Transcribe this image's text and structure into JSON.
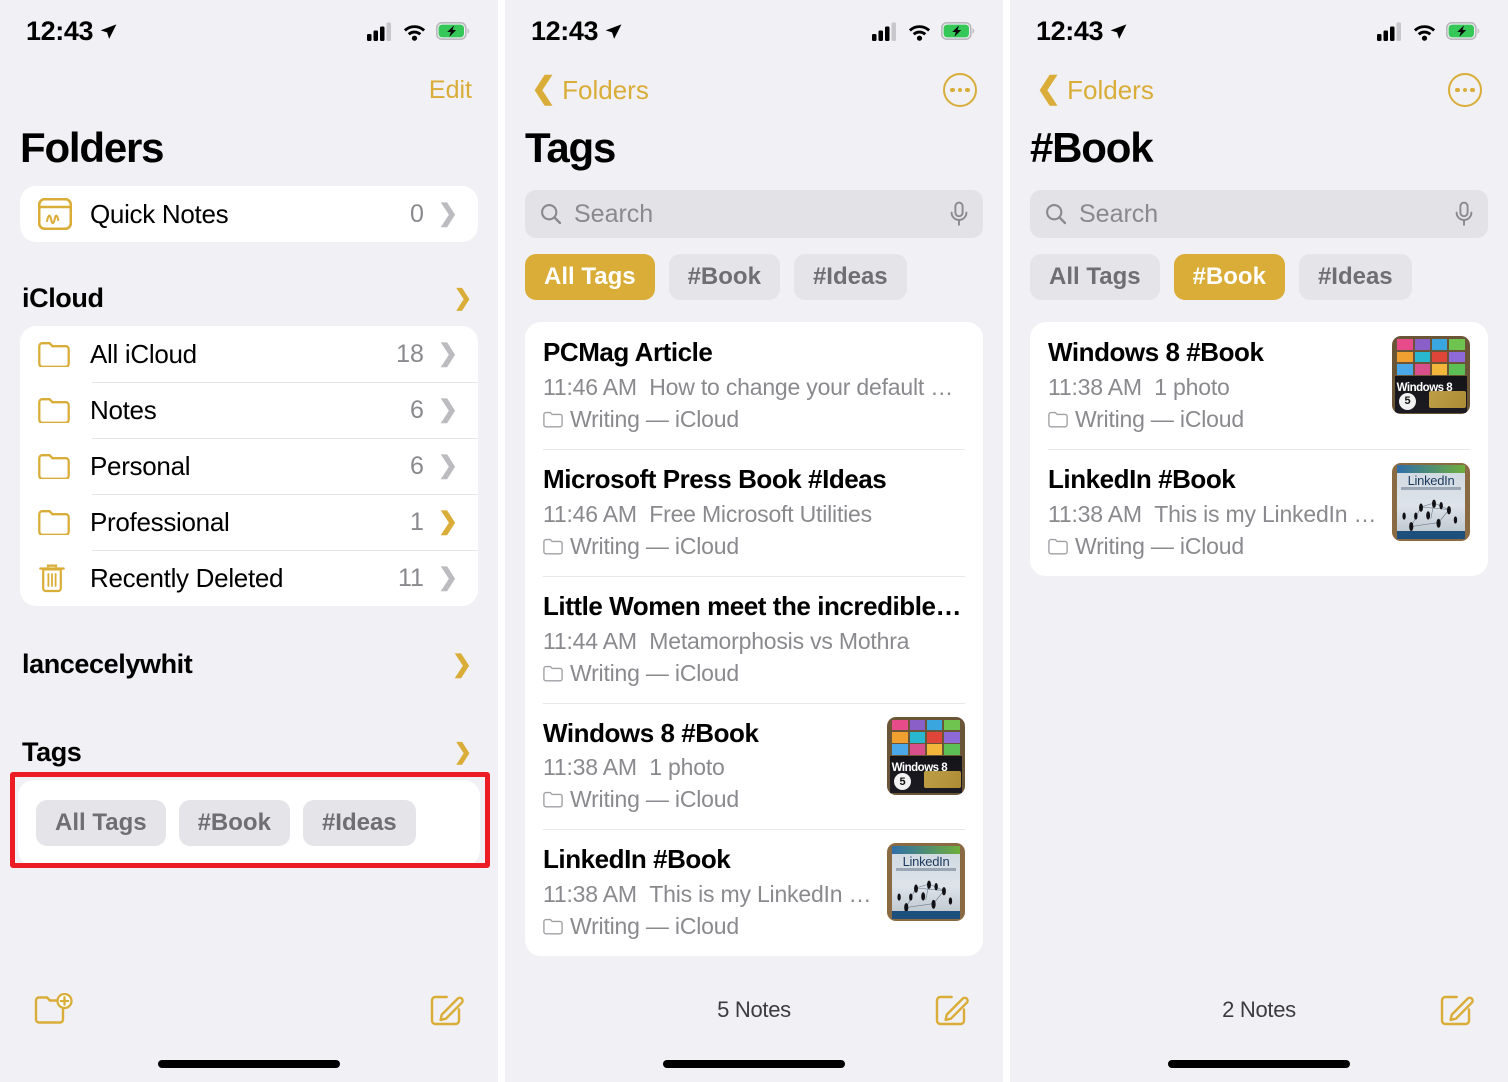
{
  "statusbar": {
    "time": "12:43",
    "location_icon": "location-arrow-icon",
    "cellular_icon": "cellular-signal-icon",
    "wifi_icon": "wifi-icon",
    "battery_icon": "battery-charging-icon"
  },
  "accent_color": "#D9AD38",
  "highlight_color": "#ED1C24",
  "panel1": {
    "edit_label": "Edit",
    "title": "Folders",
    "quick_notes": {
      "label": "Quick Notes",
      "count": "0",
      "icon": "quick-notes-icon"
    },
    "icloud_section": {
      "label": "iCloud",
      "collapse_icon": "chevron-down-icon"
    },
    "folders": [
      {
        "label": "All iCloud",
        "count": "18",
        "icon": "folder-icon",
        "chevron": "chevron-right-icon",
        "chevron_accent": false
      },
      {
        "label": "Notes",
        "count": "6",
        "icon": "folder-icon",
        "chevron": "chevron-right-icon",
        "chevron_accent": false
      },
      {
        "label": "Personal",
        "count": "6",
        "icon": "folder-icon",
        "chevron": "chevron-right-icon",
        "chevron_accent": false
      },
      {
        "label": "Professional",
        "count": "1",
        "icon": "folder-icon",
        "chevron": "chevron-right-icon",
        "chevron_accent": true
      },
      {
        "label": "Recently Deleted",
        "count": "11",
        "icon": "trash-icon",
        "chevron": "chevron-right-icon",
        "chevron_accent": false
      }
    ],
    "account_section": {
      "label": "lancecelywhit",
      "chevron": "chevron-right-icon"
    },
    "tags_section": {
      "label": "Tags",
      "collapse_icon": "chevron-down-icon"
    },
    "tag_chips": [
      {
        "label": "All Tags",
        "selected": false
      },
      {
        "label": "#Book",
        "selected": false
      },
      {
        "label": "#Ideas",
        "selected": false
      }
    ],
    "footer": {
      "new_folder_icon": "new-folder-icon",
      "compose_icon": "compose-note-icon"
    }
  },
  "panel2": {
    "back_label": "Folders",
    "more_icon": "more-options-icon",
    "title": "Tags",
    "search": {
      "placeholder": "Search",
      "search_icon": "search-icon",
      "mic_icon": "microphone-icon"
    },
    "tag_chips": [
      {
        "label": "All Tags",
        "selected": true
      },
      {
        "label": "#Book",
        "selected": false
      },
      {
        "label": "#Ideas",
        "selected": false
      }
    ],
    "notes": [
      {
        "title": "PCMag Article",
        "time": "11:46 AM",
        "preview": "How to change your default email…",
        "folder": "Writing — iCloud",
        "thumb": null
      },
      {
        "title": "Microsoft Press Book #Ideas",
        "time": "11:46 AM",
        "preview": "Free Microsoft Utilities",
        "folder": "Writing — iCloud",
        "thumb": null
      },
      {
        "title": "Little Women meet the incredible shri…",
        "time": "11:44 AM",
        "preview": "Metamorphosis vs Mothra",
        "folder": "Writing — iCloud",
        "thumb": null
      },
      {
        "title": "Windows 8 #Book",
        "time": "11:38 AM",
        "preview": "1 photo",
        "folder": "Writing — iCloud",
        "thumb": "windows8-book-cover"
      },
      {
        "title": "LinkedIn #Book",
        "time": "11:38 AM",
        "preview": "This is my LinkedIn book",
        "folder": "Writing — iCloud",
        "thumb": "linkedin-book-cover"
      }
    ],
    "footer": {
      "count_label": "5 Notes",
      "compose_icon": "compose-note-icon"
    }
  },
  "panel3": {
    "back_label": "Folders",
    "more_icon": "more-options-icon",
    "title": "#Book",
    "search": {
      "placeholder": "Search",
      "search_icon": "search-icon",
      "mic_icon": "microphone-icon"
    },
    "tag_chips": [
      {
        "label": "All Tags",
        "selected": false
      },
      {
        "label": "#Book",
        "selected": true
      },
      {
        "label": "#Ideas",
        "selected": false
      }
    ],
    "notes": [
      {
        "title": "Windows 8 #Book",
        "time": "11:38 AM",
        "preview": "1 photo",
        "folder": "Writing — iCloud",
        "thumb": "windows8-book-cover"
      },
      {
        "title": "LinkedIn #Book",
        "time": "11:38 AM",
        "preview": "This is my LinkedIn book",
        "folder": "Writing — iCloud",
        "thumb": "linkedin-book-cover"
      }
    ],
    "footer": {
      "count_label": "2 Notes",
      "compose_icon": "compose-note-icon"
    }
  }
}
